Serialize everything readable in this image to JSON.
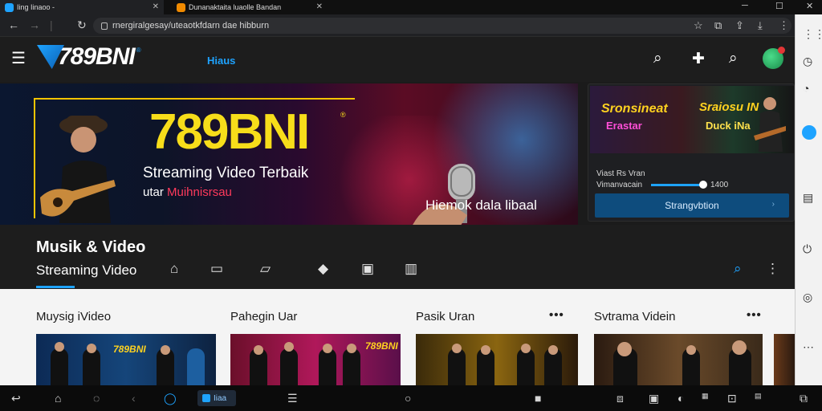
{
  "browser": {
    "tabs": [
      {
        "title": "Iing Iinaoo -",
        "fav_color": "#1ea3ff"
      },
      {
        "title": "Dunanaktaita luaolle Bandan",
        "fav_color": "#f08a00"
      }
    ],
    "url": "rnergiralgesay/uteaotkfdarn dae hibburn",
    "window_controls": [
      "─",
      "☐",
      "✕"
    ]
  },
  "header": {
    "logo_text": "789BNI",
    "logo_reg": "®",
    "nav_link": "Hiaus",
    "accent": "#1ea3ff"
  },
  "hero": {
    "title": "789BNI",
    "reg": "®",
    "subtitle": "Streaming Video Terbaik",
    "subtitle2_prefix": "utar ",
    "subtitle2_highlight": "Muihnisrsau",
    "caption": "Hiemok dala libaal"
  },
  "promo": {
    "image_left_1": "Sronsineat",
    "image_left_2": "Erastar",
    "image_right_1": "Sraiosu IN",
    "image_right_2": "Duck iNa",
    "line1": "Viast Rs Vran",
    "line2": "Vimanvacain",
    "time": "1400",
    "button": "Strangvbtion",
    "button_arrow": "›"
  },
  "section": {
    "title": "Musik & Video",
    "subtitle": "Streaming Video"
  },
  "cards": [
    {
      "title": "Muysig iVideo",
      "brand": "789BNI"
    },
    {
      "title": "Pahegin Uar",
      "brand": "789BNI"
    },
    {
      "title": "Pasik Uran",
      "brand": ""
    },
    {
      "title": "Svtrama Videin",
      "brand": ""
    }
  ],
  "card_menu": "•••",
  "taskbar": {
    "active_label": "Iiaa"
  }
}
